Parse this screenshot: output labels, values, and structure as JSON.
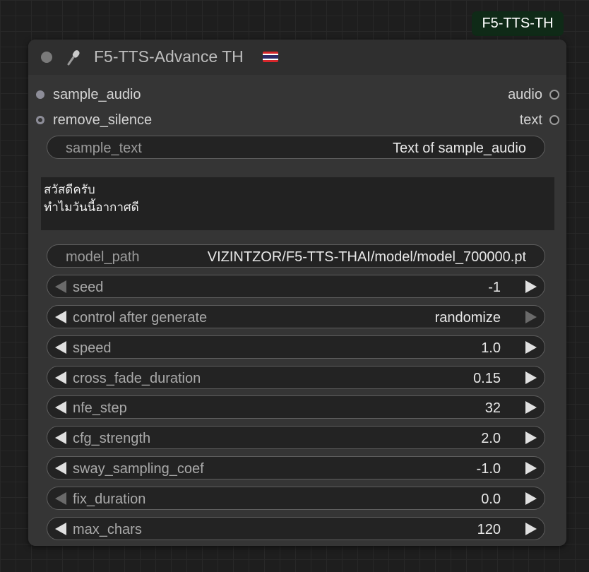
{
  "badge": {
    "label": "F5-TTS-TH"
  },
  "node": {
    "title": "F5-TTS-Advance TH",
    "icons": {
      "title_icon": "microphone-icon",
      "flag": "thailand-flag-icon"
    },
    "inputs": [
      {
        "label": "sample_audio"
      },
      {
        "label": "remove_silence"
      }
    ],
    "outputs": [
      {
        "label": "audio"
      },
      {
        "label": "text"
      }
    ],
    "sample_text": {
      "label": "sample_text",
      "value": "Text of sample_audio"
    },
    "text_area": {
      "value": "สวัสดีครับ\nทำไมวันนี้อากาศดี"
    },
    "model_path": {
      "label": "model_path",
      "value": "VIZINTZOR/F5-TTS-THAI/model/model_700000.pt"
    },
    "widgets": [
      {
        "label": "seed",
        "value": "-1"
      },
      {
        "label": "control after generate",
        "value": "randomize"
      },
      {
        "label": "speed",
        "value": "1.0"
      },
      {
        "label": "cross_fade_duration",
        "value": "0.15"
      },
      {
        "label": "nfe_step",
        "value": "32"
      },
      {
        "label": "cfg_strength",
        "value": "2.0"
      },
      {
        "label": "sway_sampling_coef",
        "value": "-1.0"
      },
      {
        "label": "fix_duration",
        "value": "0.0"
      },
      {
        "label": "max_chars",
        "value": "120"
      }
    ]
  }
}
